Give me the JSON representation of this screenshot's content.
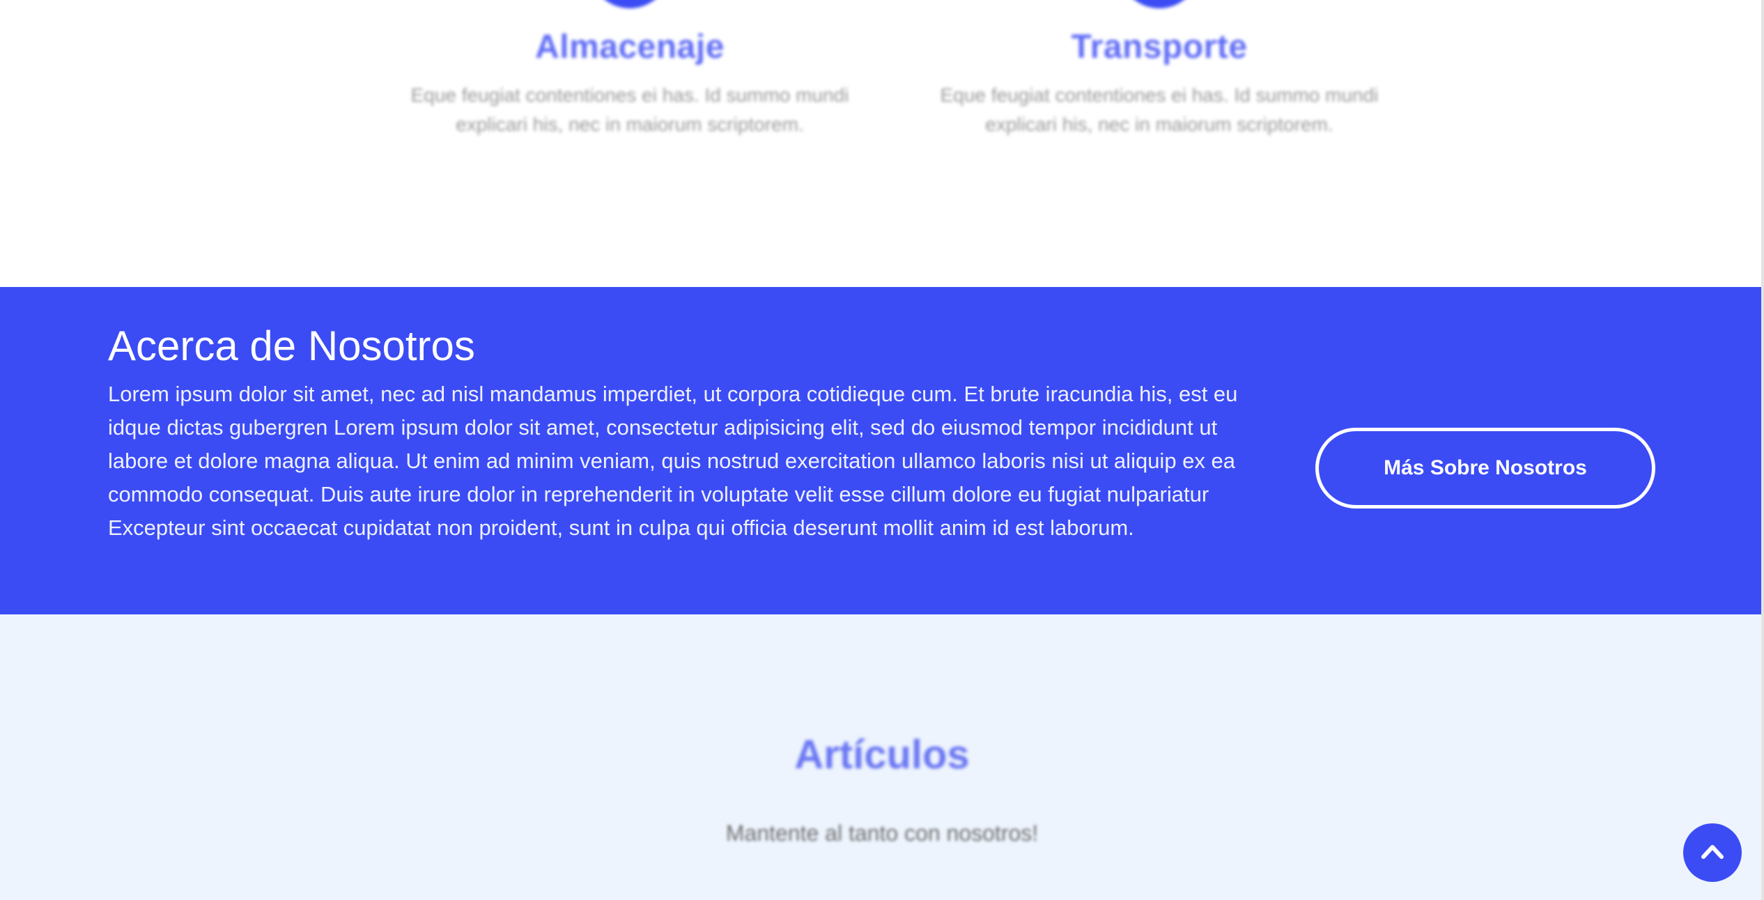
{
  "services": [
    {
      "title": "Almacenaje",
      "description": "Eque feugiat contentiones ei has. Id summo mundi explicari his, nec in maiorum scriptorem."
    },
    {
      "title": "Transporte",
      "description": "Eque feugiat contentiones ei has. Id summo mundi explicari his, nec in maiorum scriptorem."
    }
  ],
  "about": {
    "heading": "Acerca de Nosotros",
    "body": "Lorem ipsum dolor sit amet, nec ad nisl mandamus imperdiet, ut corpora cotidieque cum. Et brute iracundia his, est eu idque dictas gubergren Lorem ipsum dolor sit amet, consectetur adipisicing elit, sed do eiusmod tempor incididunt ut labore et dolore magna aliqua. Ut enim ad minim veniam, quis nostrud exercitation ullamco laboris nisi ut aliquip ex ea commodo consequat. Duis aute irure dolor in reprehenderit in voluptate velit esse cillum dolore eu fugiat nulpariatur Excepteur sint occaecat cupidatat non proident, sunt in culpa qui officia deserunt mollit anim id est laborum.",
    "button_label": "Más Sobre Nosotros"
  },
  "articles": {
    "title": "Artículos",
    "subtitle": "Mantente al tanto con nosotros!"
  },
  "icons": {
    "service_icon": "service-circle-icon",
    "scroll_top": "chevron-up-icon"
  },
  "colors": {
    "primary": "#3b4cf5",
    "section_bg": "#edf4fd",
    "text_muted": "#9a9a9a"
  }
}
